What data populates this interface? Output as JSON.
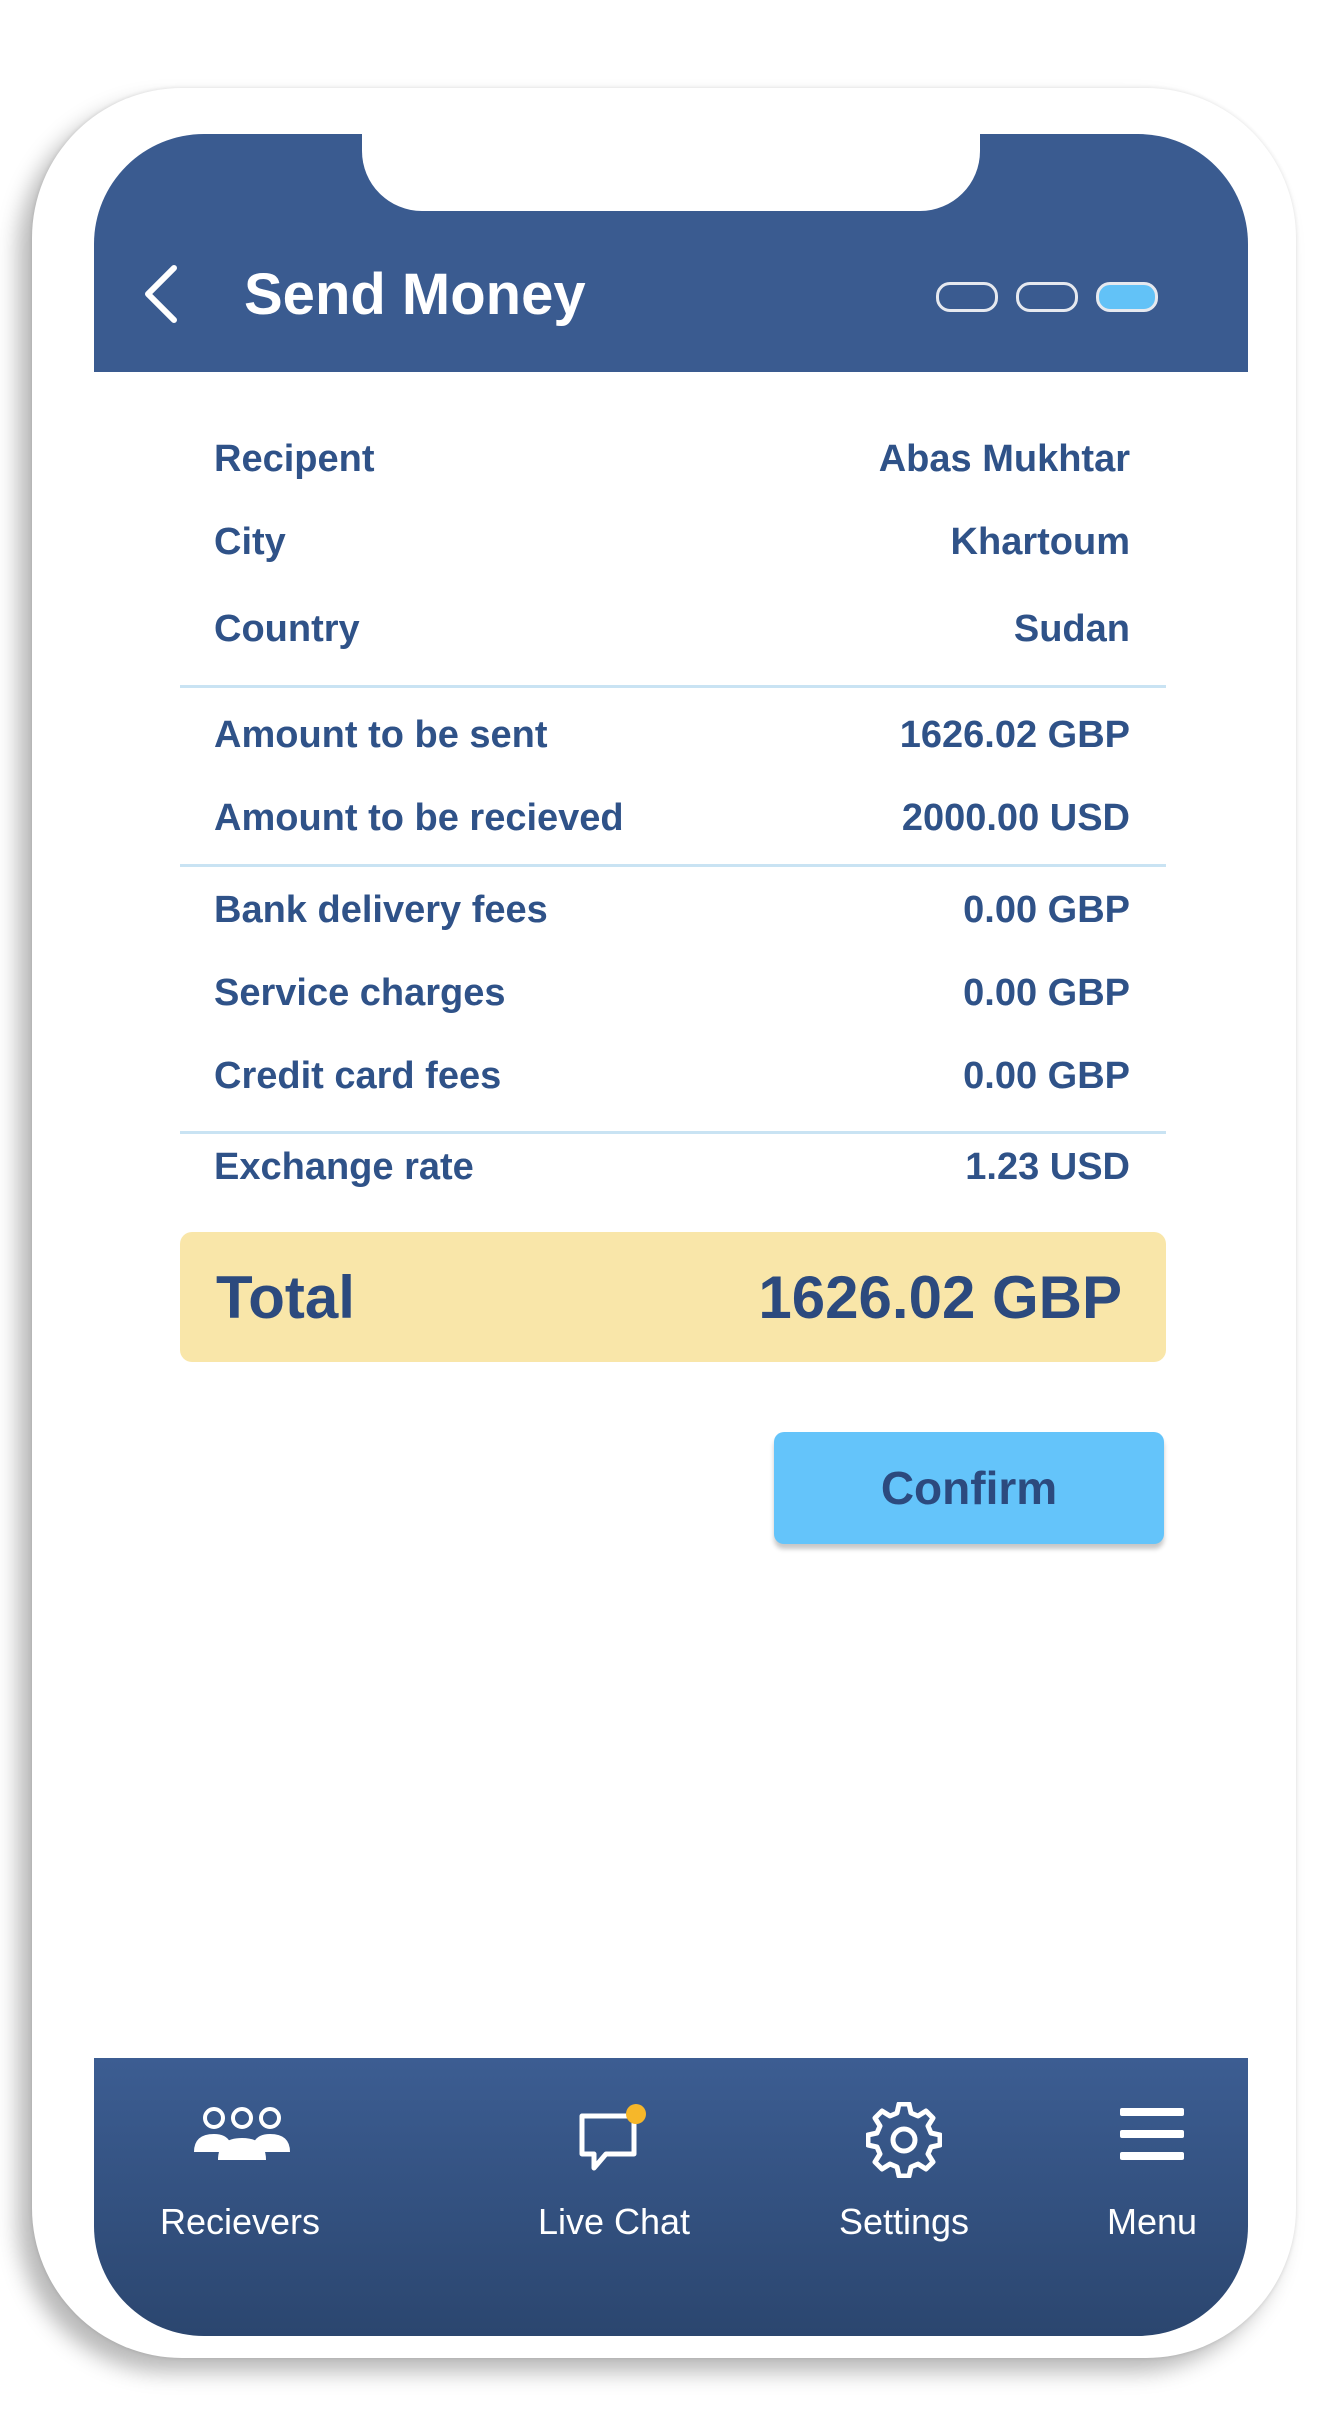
{
  "header": {
    "title": "Send Money",
    "steps_total": 3,
    "active_step": 3
  },
  "details": [
    {
      "label": "Recipent",
      "value": "Abas Mukhtar"
    },
    {
      "label": "City",
      "value": "Khartoum"
    },
    {
      "label": "Country",
      "value": "Sudan"
    },
    {
      "label": "Amount to be sent",
      "value": "1626.02 GBP"
    },
    {
      "label": "Amount to be recieved",
      "value": "2000.00 USD"
    },
    {
      "label": "Bank delivery fees",
      "value": "0.00 GBP"
    },
    {
      "label": "Service charges",
      "value": "0.00 GBP"
    },
    {
      "label": "Credit card fees",
      "value": "0.00 GBP"
    },
    {
      "label": "Exchange rate",
      "value": "1.23 USD"
    }
  ],
  "total": {
    "label": "Total",
    "value": "1626.02 GBP"
  },
  "confirm_label": "Confirm",
  "nav": [
    {
      "label": "Recievers",
      "icon": "users-icon"
    },
    {
      "label": "Live Chat",
      "icon": "chat-icon"
    },
    {
      "label": "Settings",
      "icon": "gear-icon"
    },
    {
      "label": "Menu",
      "icon": "menu-icon"
    }
  ],
  "colors": {
    "header": "#3a5b90",
    "text": "#2f5288",
    "total_bg": "#f9e6a9",
    "confirm_bg": "#64c4fa",
    "active_step": "#62c2f7",
    "notification_dot": "#f6b72a"
  }
}
